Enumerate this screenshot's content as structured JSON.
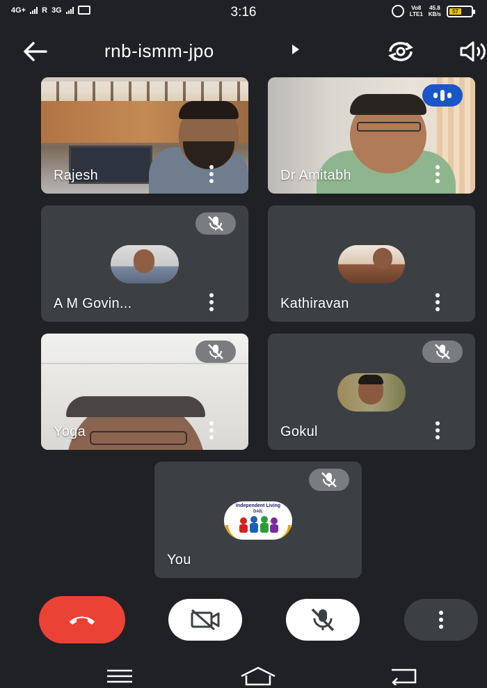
{
  "status_bar": {
    "network_left": "4G+",
    "network_right": "3G",
    "roaming": "R",
    "time": "3:16",
    "volte": "Vo8\nLTE1",
    "speed_value": "45.8",
    "speed_unit": "KB/s",
    "battery_level": "57"
  },
  "header": {
    "meeting_code": "rnb-ismm-jpo"
  },
  "participants": [
    {
      "name": "Rajesh",
      "video": true,
      "muted": false
    },
    {
      "name": "Dr Amitabh",
      "video": true,
      "speaking": true
    },
    {
      "name": "A M Govin...",
      "video": false,
      "muted": true
    },
    {
      "name": "Kathiravan",
      "video": false,
      "muted": false
    },
    {
      "name": "Yoga",
      "video": true,
      "muted": true
    },
    {
      "name": "Gokul",
      "video": false,
      "muted": true
    },
    {
      "name": "You",
      "video": false,
      "muted": true,
      "avatar_text_1": "Independent Living",
      "avatar_text_2": "DAIL"
    }
  ],
  "controls": {
    "end_call_color": "#ea4335",
    "icons": [
      "end-call-icon",
      "camera-off-icon",
      "mic-off-icon",
      "more-vert-icon"
    ]
  },
  "colors": {
    "background": "#202124",
    "tile": "#3c4043",
    "speaking_badge": "#1a56c8"
  }
}
